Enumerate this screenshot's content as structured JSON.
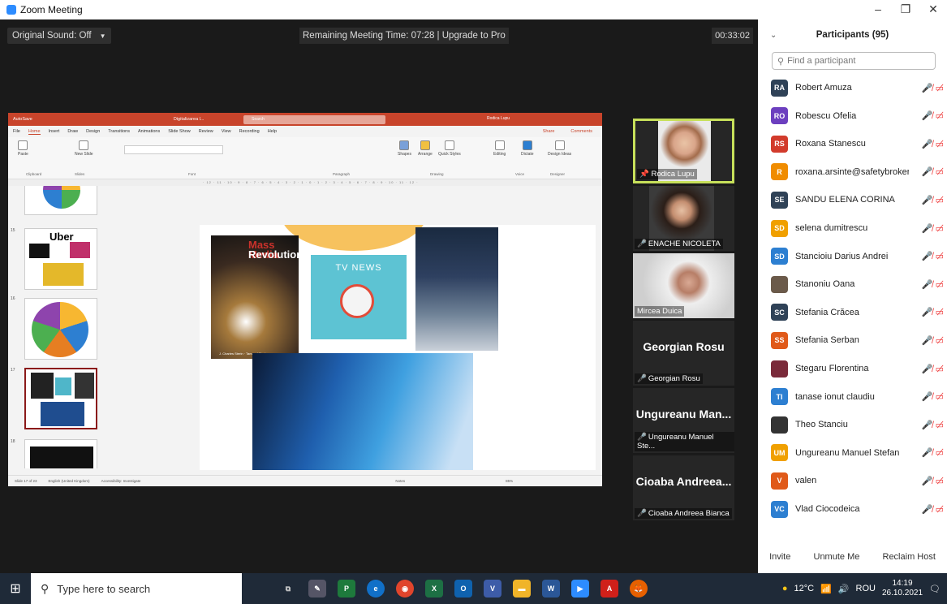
{
  "window": {
    "title": "Zoom Meeting",
    "controls": [
      "–",
      "❐",
      "✕"
    ]
  },
  "topbar": {
    "sound": "Original Sound: Off",
    "remaining": "Remaining Meeting Time: 07:28 | Upgrade to Pro",
    "timer": "00:33:02"
  },
  "ppt": {
    "autosave": "AutoSave",
    "doc": "Digitalizarea l...",
    "search": "Search",
    "user": "Rodica Lupu",
    "menu": [
      "File",
      "Home",
      "Insert",
      "Draw",
      "Design",
      "Transitions",
      "Animations",
      "Slide Show",
      "Review",
      "View",
      "Recording",
      "Help"
    ],
    "share": "Share",
    "comments": "Comments",
    "ribbon": {
      "paste": "Paste",
      "new_slide": "New Slide",
      "shapes": "Shapes",
      "arrange": "Arrange",
      "quick_styles": "Quick Styles",
      "editing": "Editing",
      "dictate": "Dictate",
      "design_ideas": "Design Ideas"
    },
    "groups": [
      "Clipboard",
      "Slides",
      "Font",
      "Paragraph",
      "Drawing",
      "Voice",
      "Designer"
    ],
    "thumb_numbers": [
      "15",
      "16",
      "17",
      "18"
    ],
    "uber": "Uber",
    "slide": {
      "book_title_1": "Mass Media",
      "book_title_2": "Revolution",
      "book_authors": "J. Charles Sterin · Tamara Winston",
      "tv_news": "TV NEWS"
    },
    "status": {
      "slide": "Slide 17 of 23",
      "lang": "English (United Kingdom)",
      "acc": "Accessibility: Investigate",
      "notes": "Notes",
      "zoom": "85%"
    }
  },
  "videos": [
    {
      "name": "Rodica Lupu",
      "type": "photo"
    },
    {
      "name": "ENACHE NICOLETA",
      "type": "photo"
    },
    {
      "name": "Mircea Duica",
      "type": "photo"
    },
    {
      "name": "Georgian Rosu",
      "big": "Georgian Rosu"
    },
    {
      "name": "Ungureanu Manuel Ste...",
      "big": "Ungureanu Man..."
    },
    {
      "name": "Cioaba Andreea Bianca",
      "big": "Cioaba Andreea..."
    }
  ],
  "panel": {
    "title": "Participants (95)",
    "find_placeholder": "Find a participant",
    "buttons": {
      "invite": "Invite",
      "unmute": "Unmute Me",
      "reclaim": "Reclaim Host"
    }
  },
  "participants": [
    {
      "initials": "RA",
      "name": "Robert Amuza",
      "color": "#2f4257"
    },
    {
      "initials": "RO",
      "name": "Robescu Ofelia",
      "color": "#6c3fbf"
    },
    {
      "initials": "RS",
      "name": "Roxana Stanescu",
      "color": "#d23b2c"
    },
    {
      "initials": "R",
      "name": "roxana.arsinte@safetybroker.ro",
      "color": "#f08c00"
    },
    {
      "initials": "SE",
      "name": "SANDU ELENA CORINA",
      "color": "#2f4257"
    },
    {
      "initials": "SD",
      "name": "selena dumitrescu",
      "color": "#f0a000"
    },
    {
      "initials": "SD",
      "name": "Stancioiu Darius Andrei",
      "color": "#2d7fd1"
    },
    {
      "initials": "",
      "name": "Stanoniu Oana",
      "color": "#6b5a4a"
    },
    {
      "initials": "SC",
      "name": "Stefania Crăcea",
      "color": "#2f4257"
    },
    {
      "initials": "SS",
      "name": "Stefania Serban",
      "color": "#e05a1a"
    },
    {
      "initials": "",
      "name": "Stegaru Florentina",
      "color": "#7a2a3a"
    },
    {
      "initials": "TI",
      "name": "tanase ionut claudiu",
      "color": "#2d7fd1"
    },
    {
      "initials": "",
      "name": "Theo Stanciu",
      "color": "#333333"
    },
    {
      "initials": "UM",
      "name": "Ungureanu Manuel Stefan",
      "color": "#f0a000"
    },
    {
      "initials": "V",
      "name": "valen",
      "color": "#e05a1a"
    },
    {
      "initials": "VC",
      "name": "Vlad Ciocodeica",
      "color": "#2d7fd1"
    }
  ],
  "taskbar": {
    "search": "Type here to search",
    "temp": "12°C",
    "lang": "ROU",
    "time": "14:19",
    "date": "26.10.2021"
  }
}
